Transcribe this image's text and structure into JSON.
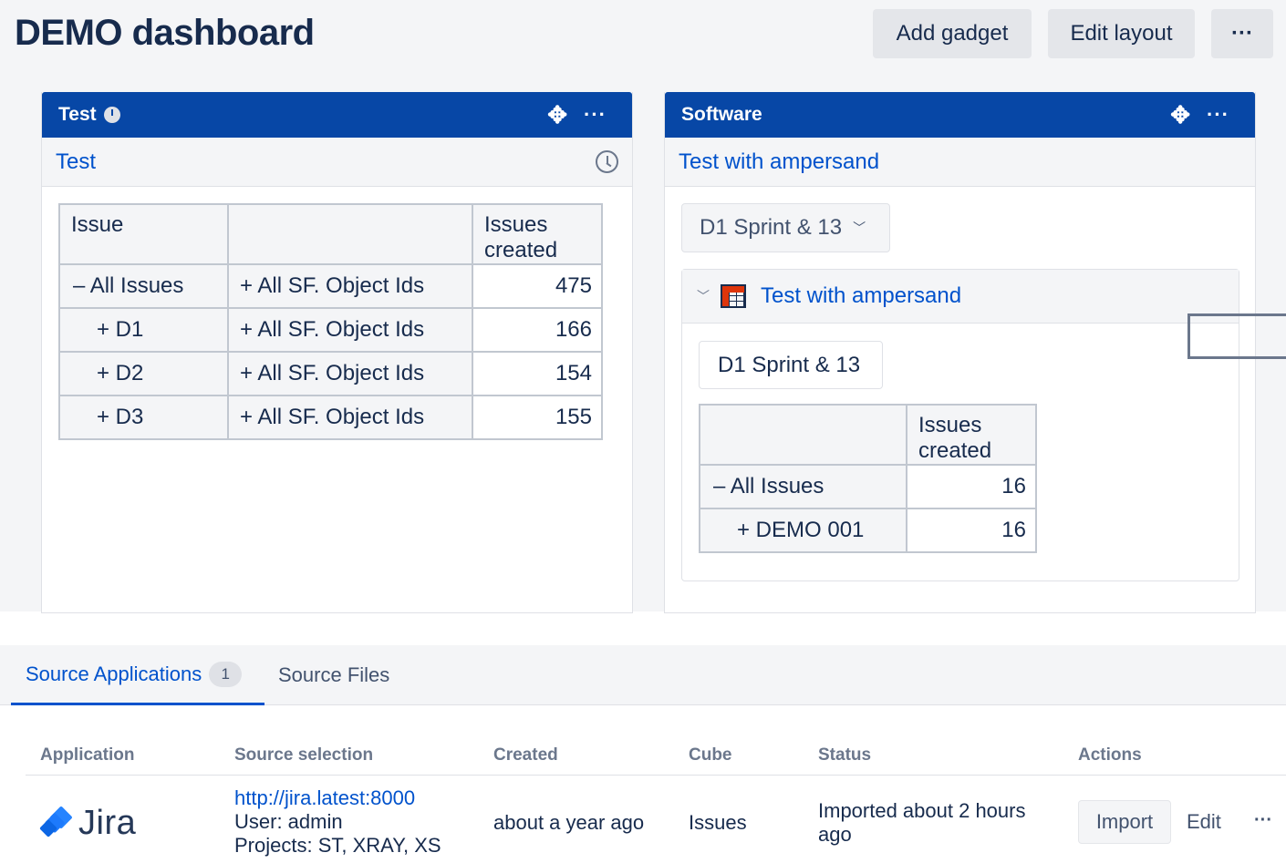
{
  "dashboard": {
    "title": "DEMO dashboard",
    "add_gadget": "Add gadget",
    "edit_layout": "Edit layout",
    "more": "···"
  },
  "gadget_left": {
    "title": "Test",
    "subtitle": "Test",
    "table": {
      "headers": [
        "Issue",
        "",
        "Issues created"
      ],
      "rows": [
        {
          "issue": "– All Issues",
          "object": "+ All SF. Object Ids",
          "value": "475"
        },
        {
          "issue": "+ D1",
          "object": "+ All SF. Object Ids",
          "value": "166"
        },
        {
          "issue": "+ D2",
          "object": "+ All SF. Object Ids",
          "value": "154"
        },
        {
          "issue": "+ D3",
          "object": "+ All SF. Object Ids",
          "value": "155"
        }
      ]
    }
  },
  "gadget_right": {
    "title": "Software",
    "subtitle": "Test with ampersand",
    "selector": "D1 Sprint & 13",
    "report_title": "Test with ampersand",
    "filter_pill": "D1 Sprint & 13",
    "table": {
      "headers": [
        "",
        "Issues created"
      ],
      "rows": [
        {
          "issue": "– All Issues",
          "value": "16"
        },
        {
          "issue": "+ DEMO 001",
          "value": "16"
        }
      ]
    }
  },
  "source": {
    "tabs": [
      {
        "label": "Source Applications",
        "count": "1"
      },
      {
        "label": "Source Files"
      }
    ],
    "columns": [
      "Application",
      "Source selection",
      "Created",
      "Cube",
      "Status",
      "Actions"
    ],
    "row": {
      "app": "Jira",
      "url": "http://jira.latest:8000",
      "user": "User: admin",
      "projects": "Projects: ST, XRAY, XS",
      "created": "about a year ago",
      "cube": "Issues",
      "status_line1": "Imported about 2 hours",
      "status_line2": "ago",
      "import": "Import",
      "edit": "Edit",
      "more": "···"
    }
  }
}
